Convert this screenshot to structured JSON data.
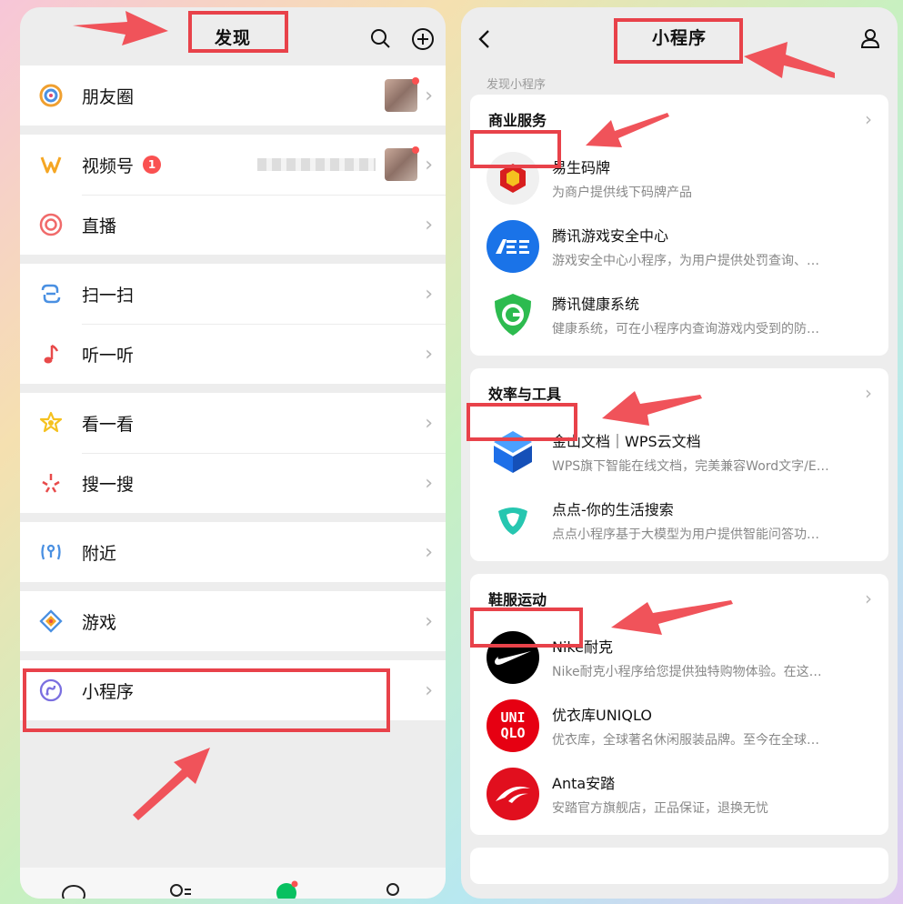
{
  "left": {
    "title": "发现",
    "groups": [
      [
        {
          "label": "朋友圈",
          "icon": "moments-icon"
        }
      ],
      [
        {
          "label": "视频号",
          "icon": "channels-icon",
          "badge": "1"
        },
        {
          "label": "直播",
          "icon": "live-icon"
        }
      ],
      [
        {
          "label": "扫一扫",
          "icon": "scan-icon"
        },
        {
          "label": "听一听",
          "icon": "listen-icon"
        }
      ],
      [
        {
          "label": "看一看",
          "icon": "top-stories-icon"
        },
        {
          "label": "搜一搜",
          "icon": "search-icon"
        }
      ],
      [
        {
          "label": "附近",
          "icon": "nearby-icon"
        }
      ],
      [
        {
          "label": "游戏",
          "icon": "games-icon"
        }
      ],
      [
        {
          "label": "小程序",
          "icon": "mini-program-icon"
        }
      ]
    ]
  },
  "right": {
    "title": "小程序",
    "caption": "发现小程序",
    "sections": [
      {
        "name": "商业服务",
        "apps": [
          {
            "name": "易生码牌",
            "desc": "为商户提供线下码牌产品",
            "color": "#d81e1e"
          },
          {
            "name": "腾讯游戏安全中心",
            "desc": "游戏安全中心小程序，为用户提供处罚查询、…",
            "color": "#1a73e8"
          },
          {
            "name": "腾讯健康系统",
            "desc": "健康系统，可在小程序内查询游戏内受到的防…",
            "color": "#2dbb4f"
          }
        ]
      },
      {
        "name": "效率与工具",
        "apps": [
          {
            "name": "金山文档｜WPS云文档",
            "desc": "WPS旗下智能在线文档，完美兼容Word文字/E…",
            "color": "#1e6fe8"
          },
          {
            "name": "点点-你的生活搜索",
            "desc": "点点小程序基于大模型为用户提供智能问答功…",
            "color": "#26c6b0"
          }
        ]
      },
      {
        "name": "鞋服运动",
        "apps": [
          {
            "name": "Nike耐克",
            "desc": "Nike耐克小程序给您提供独特购物体验。在这…",
            "color": "#000000"
          },
          {
            "name": "优衣库UNIQLO",
            "desc": "优衣库，全球著名休闲服装品牌。至今在全球…",
            "color": "#e60012"
          },
          {
            "name": "Anta安踏",
            "desc": "安踏官方旗舰店，正品保证，退换无忧",
            "color": "#e10f1e"
          }
        ]
      }
    ],
    "uniqlo_logo": [
      "UNI",
      "QLO"
    ]
  },
  "colors": {
    "highlight": "#e8424a",
    "badge": "#fa5151"
  }
}
